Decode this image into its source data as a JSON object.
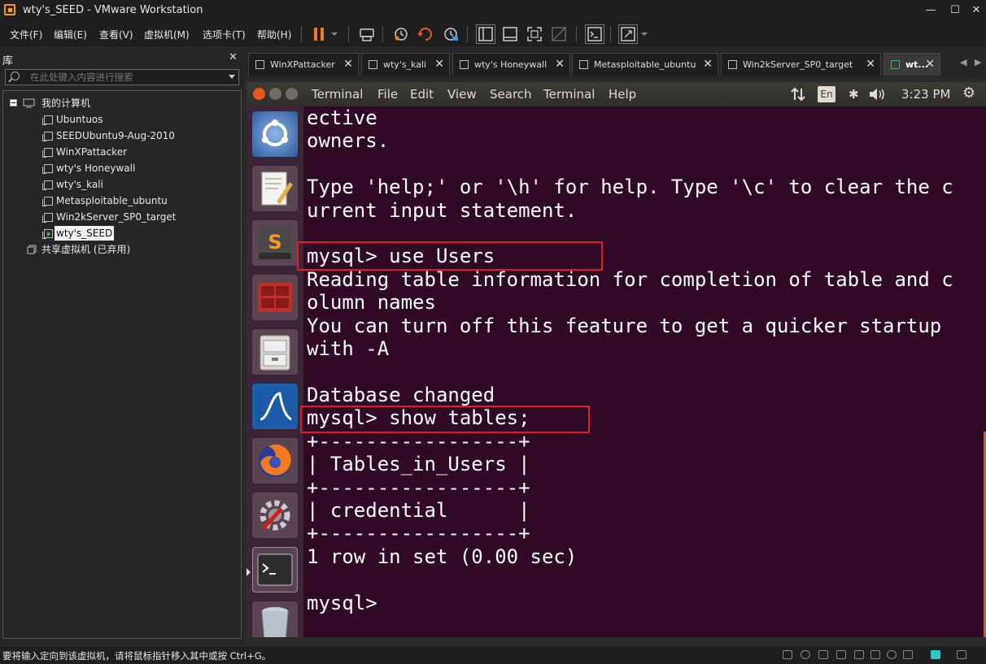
{
  "window": {
    "title": "wty's_SEED - VMware Workstation"
  },
  "menu": [
    "文件(F)",
    "编辑(E)",
    "查看(V)",
    "虚拟机(M)",
    "选项卡(T)",
    "帮助(H)"
  ],
  "library": {
    "title": "库",
    "search_placeholder": "在此处键入内容进行搜索",
    "root": "我的计算机",
    "vms": [
      "Ubuntuos",
      "SEEDUbuntu9-Aug-2010",
      "WinXPattacker",
      "wty's Honeywall",
      "wty's_kali",
      "Metasploitable_ubuntu",
      "Win2kServer_SP0_target",
      "wty's_SEED"
    ],
    "selected_vm": "wty's_SEED",
    "shared": "共享虚拟机 (已弃用)"
  },
  "tabs": [
    "WinXPattacker",
    "wty's_kali",
    "wty's Honeywall",
    "Metasploitable_ubuntu",
    "Win2kServer_SP0_target",
    "wt..."
  ],
  "active_tab": "wt...",
  "guest": {
    "menubar": [
      "Terminal",
      "File",
      "Edit",
      "View",
      "Search",
      "Terminal",
      "Help"
    ],
    "keyboard_layout": "En",
    "clock": "3:23 PM",
    "terminal_lines": [
      "ective",
      "owners.",
      "",
      "Type 'help;' or '\\h' for help. Type '\\c' to clear the c",
      "urrent input statement.",
      "",
      "mysql> use Users",
      "Reading table information for completion of table and c",
      "olumn names",
      "You can turn off this feature to get a quicker startup",
      "with -A",
      "",
      "Database changed",
      "mysql> show tables;",
      "+-----------------+",
      "| Tables_in_Users |",
      "+-----------------+",
      "| credential      |",
      "+-----------------+",
      "1 row in set (0.00 sec)",
      "",
      "mysql>"
    ],
    "launcher_icons": [
      "ubuntu-dash-icon",
      "text-editor-icon",
      "sublime-text-icon",
      "terminal-split-icon",
      "file-cabinet-icon",
      "wireshark-icon",
      "firefox-icon",
      "settings-icon",
      "terminal-icon",
      "trash-icon"
    ]
  },
  "statusbar": {
    "message": "要将输入定向到该虚拟机，请将鼠标指针移入其中或按 Ctrl+G。"
  },
  "colors": {
    "terminal_bg": "#300a24",
    "highlight": "#e02020",
    "accent": "#f29b1e"
  }
}
